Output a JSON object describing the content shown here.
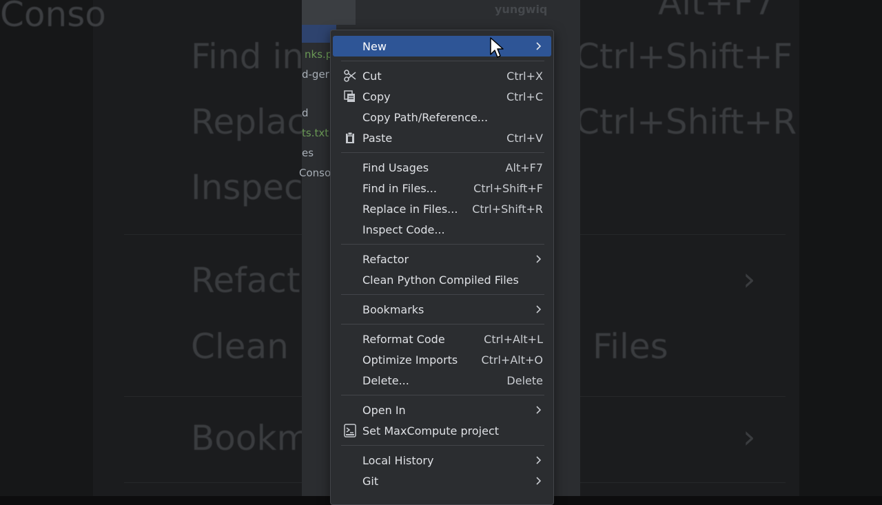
{
  "background": {
    "left_text": "Conso",
    "ghost_items": [
      "Find in",
      "Replac",
      "Inspect",
      "Refacto",
      "Clean P",
      "Bookm"
    ],
    "ghost_shortcuts": [
      "Alt+F7",
      "Ctrl+Shift+F",
      "Ctrl+Shift+R"
    ],
    "ghost_tail": "Files"
  },
  "ide": {
    "username": "yungwiq",
    "tree": [
      "nks.p",
      "d-ger",
      "d",
      "ts.txt",
      "es",
      "Conso"
    ]
  },
  "menu": {
    "new": {
      "label": "New"
    },
    "cut": {
      "label": "Cut",
      "shortcut": "Ctrl+X",
      "icon": "scissors-icon"
    },
    "copy": {
      "label": "Copy",
      "shortcut": "Ctrl+C",
      "icon": "copy-icon"
    },
    "copy_path": {
      "label": "Copy Path/Reference..."
    },
    "paste": {
      "label": "Paste",
      "shortcut": "Ctrl+V",
      "icon": "clipboard-icon"
    },
    "find_usages": {
      "label": "Find Usages",
      "shortcut": "Alt+F7"
    },
    "find_in_files": {
      "label": "Find in Files...",
      "shortcut": "Ctrl+Shift+F"
    },
    "replace_in_files": {
      "label": "Replace in Files...",
      "shortcut": "Ctrl+Shift+R"
    },
    "inspect_code": {
      "label": "Inspect Code..."
    },
    "refactor": {
      "label": "Refactor"
    },
    "clean_python": {
      "label": "Clean Python Compiled Files"
    },
    "bookmarks": {
      "label": "Bookmarks"
    },
    "reformat_code": {
      "label": "Reformat Code",
      "shortcut": "Ctrl+Alt+L"
    },
    "optimize_imports": {
      "label": "Optimize Imports",
      "shortcut": "Ctrl+Alt+O"
    },
    "delete": {
      "label": "Delete...",
      "shortcut": "Delete"
    },
    "open_in": {
      "label": "Open In"
    },
    "set_maxcompute": {
      "label": "Set MaxCompute project",
      "icon": "maxcompute-icon"
    },
    "local_history": {
      "label": "Local History"
    },
    "git": {
      "label": "Git"
    }
  },
  "colors": {
    "menu_bg": "#2b2d30",
    "highlight": "#2e5596",
    "text": "#dfe1e5"
  }
}
